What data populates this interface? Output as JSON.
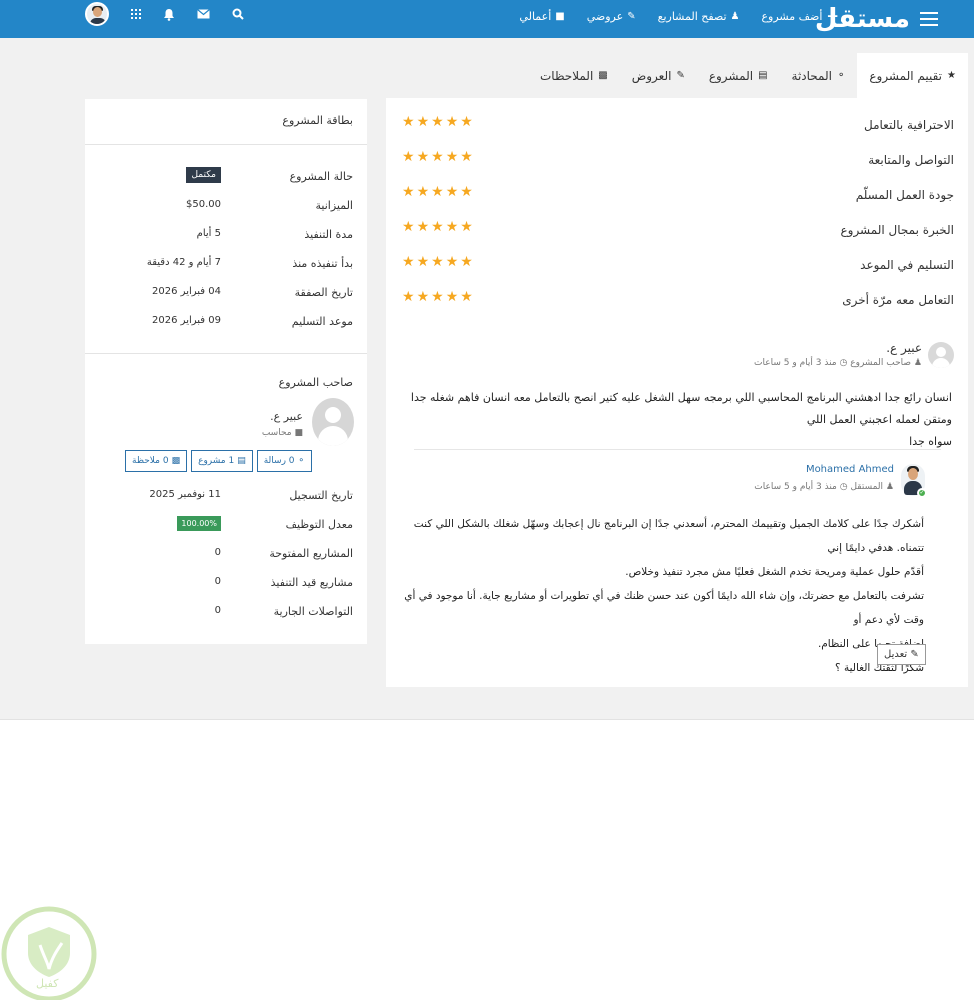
{
  "brand": {
    "name": "مستقل"
  },
  "nav": {
    "links": [
      {
        "label": "أضف مشروع",
        "icon": "plus-icon"
      },
      {
        "label": "تصفح المشاريع",
        "icon": "users-icon"
      },
      {
        "label": "عروضي",
        "icon": "edit-icon"
      },
      {
        "label": "أعمالي",
        "icon": "briefcase-icon"
      }
    ]
  },
  "tabs": [
    {
      "label": "تقييم المشروع",
      "icon": "star-icon",
      "active": true
    },
    {
      "label": "المحادثة",
      "icon": "comments-icon"
    },
    {
      "label": "المشروع",
      "icon": "folder-icon"
    },
    {
      "label": "العروض",
      "icon": "edit-icon"
    },
    {
      "label": "الملاحظات",
      "icon": "note-icon"
    }
  ],
  "ratings": [
    {
      "label": "الاحترافية بالتعامل",
      "stars": 5
    },
    {
      "label": "التواصل والمتابعة",
      "stars": 5
    },
    {
      "label": "جودة العمل المسلّم",
      "stars": 5
    },
    {
      "label": "الخبرة بمجال المشروع",
      "stars": 5
    },
    {
      "label": "التسليم في الموعد",
      "stars": 5
    },
    {
      "label": "التعامل معه مرّة أخرى",
      "stars": 5
    }
  ],
  "review": {
    "author": "عبير ع.",
    "role": "صاحب المشروع",
    "time": "منذ 3 أيام و 5 ساعات",
    "line1": "انسان رائع جدا ادهشني البرنامج المحاسبي اللي برمجه سهل الشغل عليه كتير انصح بالتعامل معه انسان فاهم شغله جدا ومتقن لعمله اعجبني العمل اللي",
    "line2": "سواه جدا"
  },
  "reply": {
    "author": "Mohamed Ahmed",
    "role": "المستقل",
    "time": "منذ 3 أيام و 5 ساعات",
    "lines": [
      "أشكرك جدًا على كلامك الجميل وتقييمك المحترم، أسعدني جدًا إن البرنامج نال إعجابك وسهّل شغلك بالشكل اللي كنت تتمناه. هدفي دايمًا إني",
      "أقدّم حلول عملية ومريحة تخدم الشغل فعليًا مش مجرد تنفيذ وخلاص.",
      "تشرفت بالتعامل مع حضرتك، وإن شاء الله دايمًا أكون عند حسن ظنك في أي تطويرات أو مشاريع جاية. أنا موجود في أي وقت لأي دعم أو",
      "إضافة تحبها على النظام.",
      "شكرًا لثقتك الغالية ؟"
    ],
    "edit_label": "تعديل"
  },
  "project_card": {
    "title": "بطاقة المشروع",
    "status_label": "حالة المشروع",
    "status_value": "مكتمل",
    "budget_label": "الميزانية",
    "budget_value": "$50.00",
    "duration_label": "مدة التنفيذ",
    "duration_value": "5 أيام",
    "started_label": "بدأ تنفيذه منذ",
    "started_value": "7 أيام و 42 دقيقة",
    "deal_date_label": "تاريخ الصفقة",
    "deal_date_value": "04 فبراير 2026",
    "delivery_label": "موعد التسليم",
    "delivery_value": "09 فبراير 2026"
  },
  "owner": {
    "heading": "صاحب المشروع",
    "name": "عبير ع.",
    "role": "محاسب",
    "btn_message": "0 رسالة",
    "btn_project": "1 مشروع",
    "btn_note": "0 ملاحظة",
    "registered_label": "تاريخ التسجيل",
    "registered_value": "11 نوفمبر 2025",
    "hire_rate_label": "معدل التوظيف",
    "hire_rate_value": "100.00%",
    "open_label": "المشاريع المفتوحة",
    "open_value": "0",
    "in_progress_label": "مشاريع قيد التنفيذ",
    "in_progress_value": "0",
    "conversations_label": "التواصلات الجارية",
    "conversations_value": "0"
  },
  "watermark": {
    "text": "كفيل"
  },
  "colors": {
    "navbar": "#2386c8",
    "star": "#f6a821",
    "status_badge": "#2f3b4a",
    "rate_badge": "#3a9a5a",
    "link_blue": "#2b70a8"
  }
}
